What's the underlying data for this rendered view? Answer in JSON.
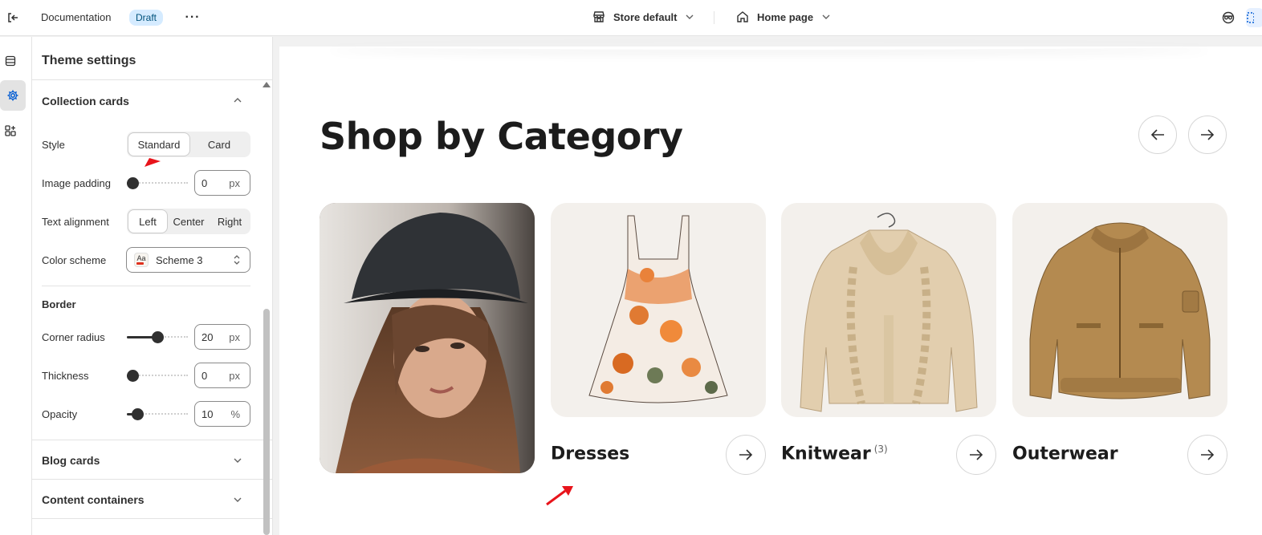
{
  "topbar": {
    "doc_title": "Documentation",
    "status_badge": "Draft",
    "more": "···",
    "store_selector": "Store default",
    "page_selector": "Home page"
  },
  "panel": {
    "title": "Theme settings",
    "collection_cards": {
      "heading": "Collection cards",
      "style": {
        "label": "Style",
        "options": [
          "Standard",
          "Card"
        ],
        "selected": "Standard"
      },
      "image_padding": {
        "label": "Image padding",
        "value": "0",
        "unit": "px",
        "fraction": 0
      },
      "text_alignment": {
        "label": "Text alignment",
        "options": [
          "Left",
          "Center",
          "Right"
        ],
        "selected": "Left"
      },
      "color_scheme": {
        "label": "Color scheme",
        "swatch": "Aa",
        "value": "Scheme 3"
      }
    },
    "border": {
      "heading": "Border",
      "corner_radius": {
        "label": "Corner radius",
        "value": "20",
        "unit": "px",
        "fraction": 0.5
      },
      "thickness": {
        "label": "Thickness",
        "value": "0",
        "unit": "px",
        "fraction": 0
      },
      "opacity": {
        "label": "Opacity",
        "value": "10",
        "unit": "%",
        "fraction": 0.1
      }
    },
    "blog_cards": {
      "heading": "Blog cards"
    },
    "content_containers": {
      "heading": "Content containers"
    }
  },
  "preview": {
    "section_title": "Shop by Category",
    "cards": [
      {
        "name": "Dresses",
        "count": ""
      },
      {
        "name": "Knitwear",
        "count": "(3)"
      },
      {
        "name": "Outerwear",
        "count": ""
      }
    ]
  },
  "colors": {
    "accent": "#005bd3",
    "draft_bg": "#d5ebff",
    "draft_text": "#00527c",
    "card_bg": "#f3f0ec",
    "annotation": "#e8141b"
  }
}
